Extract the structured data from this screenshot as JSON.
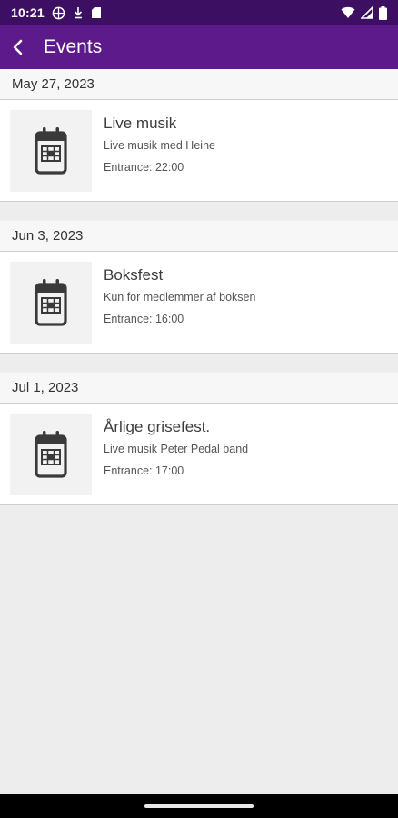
{
  "status_bar": {
    "time": "10:21",
    "left_icons": [
      "vpn-globe-icon",
      "download-icon",
      "sd-card-icon"
    ],
    "right_icons": [
      "wifi-icon",
      "signal-icon",
      "battery-icon"
    ]
  },
  "app_bar": {
    "title": "Events",
    "back_icon": "back-arrow-icon"
  },
  "sections": [
    {
      "date": "May 27, 2023",
      "events": [
        {
          "title": "Live musik",
          "description": "Live musik med Heine",
          "entrance": "Entrance: 22:00",
          "icon": "calendar-icon"
        }
      ]
    },
    {
      "date": "Jun 3, 2023",
      "events": [
        {
          "title": "Boksfest",
          "description": "Kun for medlemmer af boksen",
          "entrance": "Entrance: 16:00",
          "icon": "calendar-icon"
        }
      ]
    },
    {
      "date": "Jul 1, 2023",
      "events": [
        {
          "title": "Årlige grisefest.",
          "description": "Live musik Peter Pedal band",
          "entrance": "Entrance: 17:00",
          "icon": "calendar-icon"
        }
      ]
    }
  ],
  "colors": {
    "status_bar": "#3d0f63",
    "app_bar": "#5c1a8a",
    "background": "#ededed"
  }
}
